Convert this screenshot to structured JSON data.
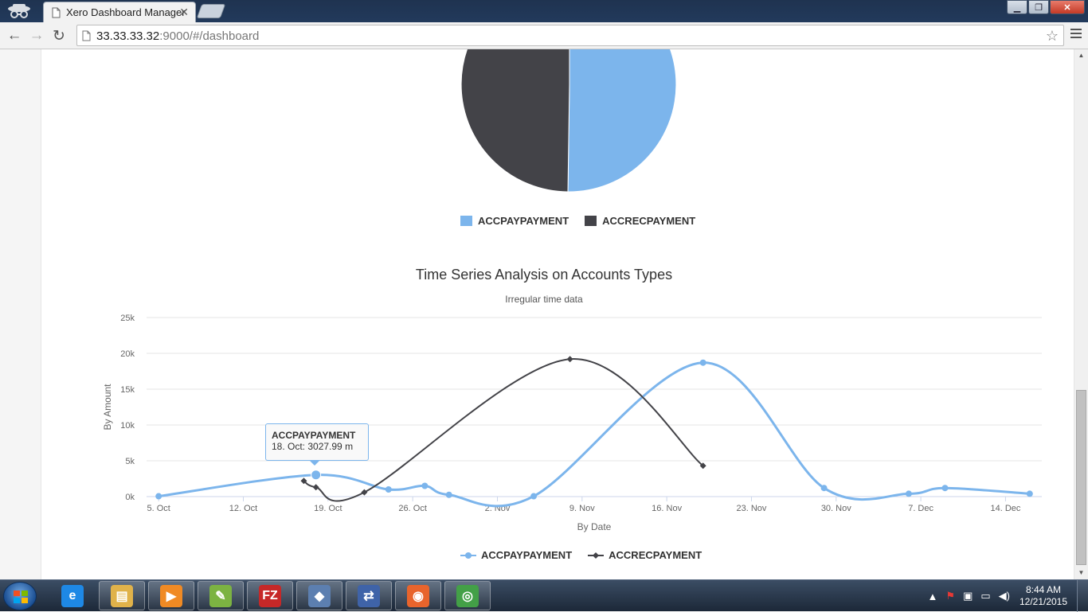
{
  "browser": {
    "tab_title": "Xero Dashboard Manager",
    "tab_close": "✕",
    "url_host": "33.33.33.32",
    "url_rest": ":9000/#/dashboard",
    "back": "←",
    "forward": "→",
    "reload": "↻",
    "star": "☆",
    "win_minimize": "▁",
    "win_maximize": "❐",
    "win_close": "✕"
  },
  "pie": {
    "legend": [
      {
        "label": "ACCPAYPAYMENT",
        "color": "#7cb5ec"
      },
      {
        "label": "ACCRECPAYMENT",
        "color": "#434348"
      }
    ]
  },
  "chart_data": {
    "type": "line",
    "title": "Time Series Analysis on Accounts Types",
    "subtitle": "Irregular time data",
    "xlabel": "By Date",
    "ylabel": "By Amount",
    "ylim": [
      0,
      25000
    ],
    "y_ticks": [
      "0k",
      "5k",
      "10k",
      "15k",
      "20k",
      "25k"
    ],
    "x_ticks": [
      "5. Oct",
      "12. Oct",
      "19. Oct",
      "26. Oct",
      "2. Nov",
      "9. Nov",
      "16. Nov",
      "23. Nov",
      "30. Nov",
      "7. Dec",
      "14. Dec"
    ],
    "grid": true,
    "legend_position": "bottom-center",
    "series": [
      {
        "name": "ACCPAYPAYMENT",
        "color": "#7cb5ec",
        "marker": "circle",
        "points": [
          [
            "2015-10-05",
            50
          ],
          [
            "2015-10-18",
            3028
          ],
          [
            "2015-10-24",
            1000
          ],
          [
            "2015-10-27",
            1500
          ],
          [
            "2015-10-29",
            250
          ],
          [
            "2015-11-05",
            50
          ],
          [
            "2015-11-19",
            18700
          ],
          [
            "2015-11-29",
            1200
          ],
          [
            "2015-12-06",
            400
          ],
          [
            "2015-12-09",
            1200
          ],
          [
            "2015-12-16",
            400
          ]
        ]
      },
      {
        "name": "ACCRECPAYMENT",
        "color": "#434348",
        "marker": "diamond",
        "points": [
          [
            "2015-10-17",
            2200
          ],
          [
            "2015-10-18",
            1300
          ],
          [
            "2015-10-22",
            600
          ],
          [
            "2015-11-08",
            19200
          ],
          [
            "2015-11-19",
            4300
          ]
        ]
      }
    ]
  },
  "tooltip": {
    "series": "ACCPAYPAYMENT",
    "text": "18. Oct: 3027.99 m"
  },
  "taskbar": {
    "apps": [
      {
        "name": "internet-explorer",
        "label": "e",
        "color": "#1e88e5"
      },
      {
        "name": "file-explorer",
        "label": "▤",
        "color": "#e0b24a"
      },
      {
        "name": "media-player",
        "label": "▶",
        "color": "#f08a24"
      },
      {
        "name": "notepad-plus",
        "label": "✎",
        "color": "#7cb342"
      },
      {
        "name": "filezilla",
        "label": "FZ",
        "color": "#c62828"
      },
      {
        "name": "mysql-workbench",
        "label": "◆",
        "color": "#5c7fb0"
      },
      {
        "name": "network-app",
        "label": "⇄",
        "color": "#3f63a8"
      },
      {
        "name": "firefox",
        "label": "◉",
        "color": "#e8642c"
      },
      {
        "name": "chrome",
        "label": "◎",
        "color": "#43a047"
      }
    ],
    "time": "8:44 AM",
    "date": "12/21/2015"
  }
}
